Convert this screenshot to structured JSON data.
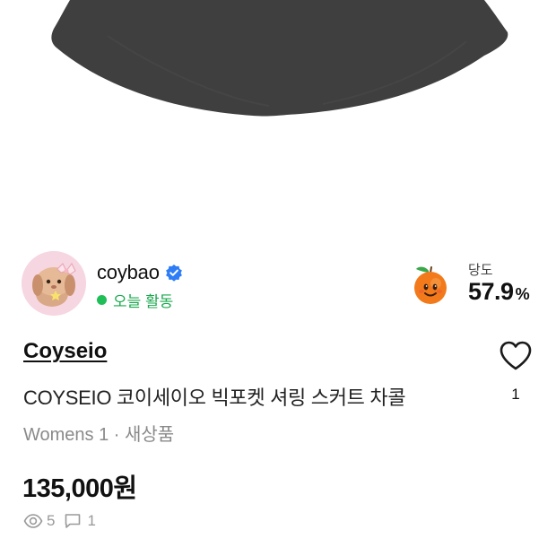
{
  "seller": {
    "name": "coybao",
    "activity": "오늘 활동"
  },
  "sweetness": {
    "label": "당도",
    "value": "57.9",
    "unit": "%"
  },
  "product": {
    "brand": "Coyseio",
    "title": "COYSEIO 코이세이오 빅포켓 셔링 스커트 차콜",
    "meta": "Womens 1 · 새상품",
    "price": "135,000원",
    "like_count": "1"
  },
  "stats": {
    "views": "5",
    "chats": "1"
  },
  "colors": {
    "skirt": "#3f3f3f",
    "active_green": "#1fbe57",
    "verified_blue": "#2e7cf6"
  },
  "icons": {
    "verified": "verified-badge-icon",
    "heart": "heart-outline-icon",
    "views": "eye-icon",
    "chats": "chat-bubble-icon",
    "sweetness": "peach-character-icon"
  }
}
